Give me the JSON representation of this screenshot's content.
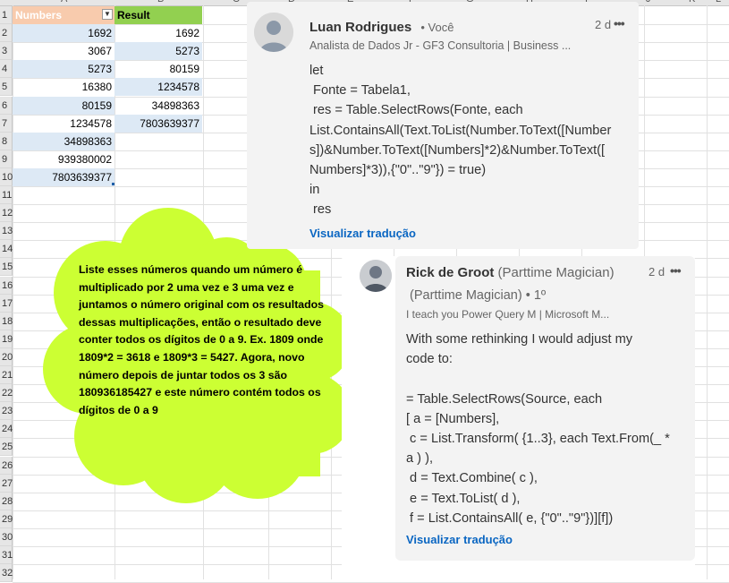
{
  "sheet": {
    "col_letters": [
      "A",
      "B",
      "C",
      "D",
      "E",
      "F",
      "G",
      "H",
      "I",
      "J",
      "K",
      "L",
      "M",
      "N",
      "O",
      "P",
      "Q",
      "R",
      "S"
    ],
    "row_numbers": [
      "1",
      "2",
      "3",
      "4",
      "5",
      "6",
      "7",
      "8",
      "9",
      "10",
      "11",
      "12",
      "13",
      "14",
      "15",
      "16",
      "17",
      "18",
      "19",
      "20",
      "21",
      "22",
      "23",
      "24",
      "25",
      "26",
      "27",
      "28",
      "29",
      "30",
      "31",
      "32"
    ],
    "numbers_header": "Numbers",
    "result_header": "Result",
    "numbers": [
      "1692",
      "3067",
      "5273",
      "16380",
      "80159",
      "1234578",
      "34898363",
      "939380002",
      "7803639377"
    ],
    "results": [
      "1692",
      "5273",
      "80159",
      "1234578",
      "34898363",
      "7803639377"
    ],
    "colors": {
      "numbers_header": "#f8cbad",
      "result_header": "#92d050",
      "banded_row": "#dde9f5"
    }
  },
  "callout": {
    "text": "Liste esses números quando um número é multiplicado por 2 uma vez e 3 uma vez e juntamos o número original com os resultados dessas multiplicações, então o resultado deve conter todos os dígitos de 0 a 9. Ex. 1809 onde 1809*2 = 3618 e 1809*3 = 5427. Agora, novo número depois de juntar todos os 3 são 180936185427 e este número contém todos os dígitos de 0 a 9",
    "fill_color": "#ccff33"
  },
  "comment1": {
    "author": "Luan Rodrigues",
    "relation": "• Você",
    "headline": "Analista de Dados Jr - GF3 Consultoria | Business ...",
    "time": "2 d",
    "more": "•••",
    "code": "let\n Fonte = Tabela1,\n res = Table.SelectRows(Fonte, each\nList.ContainsAll(Text.ToList(Number.ToText([Number\ns])&Number.ToText([Numbers]*2)&Number.ToText([\nNumbers]*3)),{\"0\"..\"9\"}) = true)\nin\n res",
    "translate": "Visualizar tradução"
  },
  "comment2": {
    "author": "Rick de Groot",
    "title_inline": "(Parttime Magician)",
    "title_line2": "(Parttime Magician) • 1º",
    "headline": "I teach you Power Query M | Microsoft M...",
    "time": "2 d",
    "more": "•••",
    "body": "With some rethinking I would adjust my\ncode to:\n\n= Table.SelectRows(Source, each\n[ a = [Numbers],\n c = List.Transform( {1..3}, each Text.From(_ *\na ) ),\n d = Text.Combine( c ),\n e = Text.ToList( d ),\n f = List.ContainsAll( e, {\"0\"..\"9\"})][f])",
    "translate": "Visualizar tradução"
  }
}
